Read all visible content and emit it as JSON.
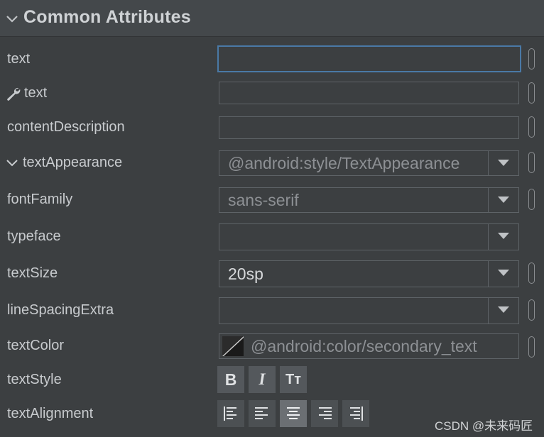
{
  "section": {
    "title": "Common Attributes"
  },
  "attributes": {
    "text": {
      "label": "text",
      "value": ""
    },
    "tools_text": {
      "label": "text",
      "value": ""
    },
    "content_description": {
      "label": "contentDescription",
      "value": ""
    },
    "text_appearance": {
      "label": "textAppearance",
      "value": "@android:style/TextAppearance"
    },
    "font_family": {
      "label": "fontFamily",
      "value": "sans-serif"
    },
    "typeface": {
      "label": "typeface",
      "value": ""
    },
    "text_size": {
      "label": "textSize",
      "value": "20sp"
    },
    "line_spacing_extra": {
      "label": "lineSpacingExtra",
      "value": ""
    },
    "text_color": {
      "label": "textColor",
      "value": "@android:color/secondary_text",
      "swatch": "black-white-diagonal"
    },
    "text_style": {
      "label": "textStyle",
      "buttons": [
        "B",
        "I",
        "Tт"
      ]
    },
    "text_alignment": {
      "label": "textAlignment",
      "options": [
        "align-start",
        "align-left",
        "align-center",
        "align-right",
        "align-end"
      ],
      "selected": "align-center"
    }
  },
  "watermark": "CSDN @未来码匠",
  "colors": {
    "background": "#3c3f41",
    "focus_border": "#4a79a6",
    "header": "#44484b"
  }
}
